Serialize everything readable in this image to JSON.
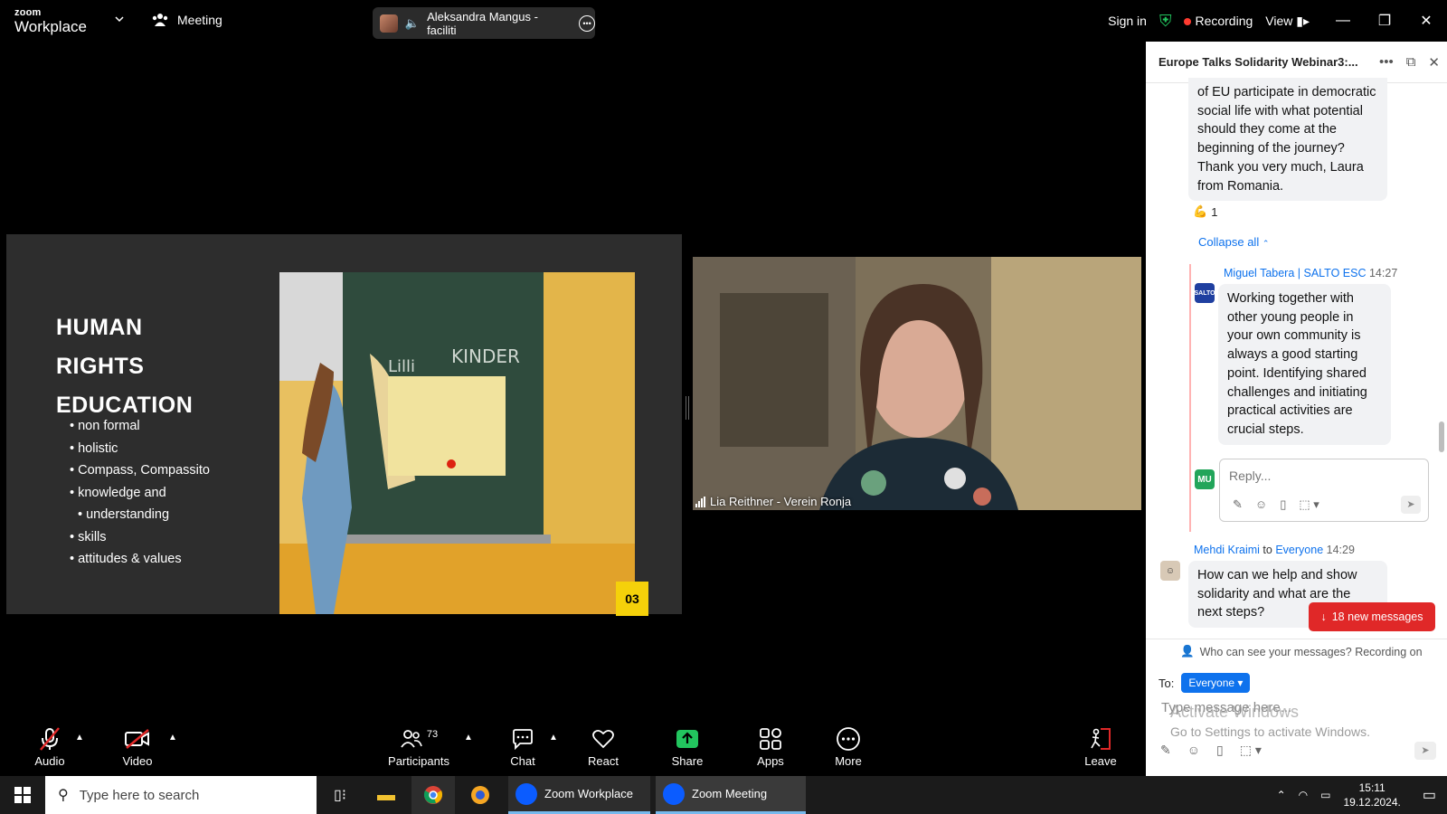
{
  "app": {
    "logo_small": "zoom",
    "logo_big": "Workplace",
    "meeting_label": "Meeting"
  },
  "speaker": {
    "name": "Aleksandra Mangus - faciliti"
  },
  "topbar": {
    "sign_in": "Sign in",
    "recording": "Recording",
    "view": "View"
  },
  "slide": {
    "title_lines": [
      "HUMAN",
      "RIGHTS",
      "EDUCATION"
    ],
    "bullets": [
      "non formal",
      "holistic",
      "Compass, Compassito",
      "knowledge and",
      "understanding",
      "skills",
      "attitudes & values"
    ],
    "board_words": [
      "Lilli",
      "KINDER"
    ],
    "number": "03"
  },
  "video": {
    "participant_name": "Lia Reithner - Verein Ronja"
  },
  "toolbar": {
    "audio": "Audio",
    "video": "Video",
    "participants": "Participants",
    "participants_count": "73",
    "chat": "Chat",
    "react": "React",
    "share": "Share",
    "apps": "Apps",
    "more": "More",
    "leave": "Leave"
  },
  "chat": {
    "title": "Europe Talks Solidarity Webinar3:...",
    "msg1_text": "of EU participate in democratic social life with what potential should they come at the beginning of the journey?  Thank you very much, Laura from Romania.",
    "reaction_count": "1",
    "collapse_all": "Collapse all",
    "msg2_sender": "Miguel Tabera | SALTO ESC",
    "msg2_time": "14:27",
    "msg2_avatar": "SALTO",
    "msg2_text": "Working together with other young people in your own community is always a good starting point. Identifying shared challenges and initiating practical activities are crucial steps.",
    "reply_avatar": "MU",
    "reply_placeholder": "Reply...",
    "msg3_sender": "Mehdi Kraimi",
    "msg3_to": "to",
    "msg3_recipient": "Everyone",
    "msg3_time": "14:29",
    "msg3_text": "How can we help and show solidarity and what are the next steps?",
    "new_messages": "18 new messages",
    "who_can_see": "Who can see your messages? Recording on",
    "to_label": "To:",
    "to_value": "Everyone",
    "type_placeholder": "Type message here...",
    "activate_title": "Activate Windows",
    "activate_sub": "Go to Settings to activate Windows."
  },
  "taskbar": {
    "search_placeholder": "Type here to search",
    "app1": "Zoom Workplace",
    "app2": "Zoom Meeting",
    "time": "15:11",
    "date": "19.12.2024."
  }
}
